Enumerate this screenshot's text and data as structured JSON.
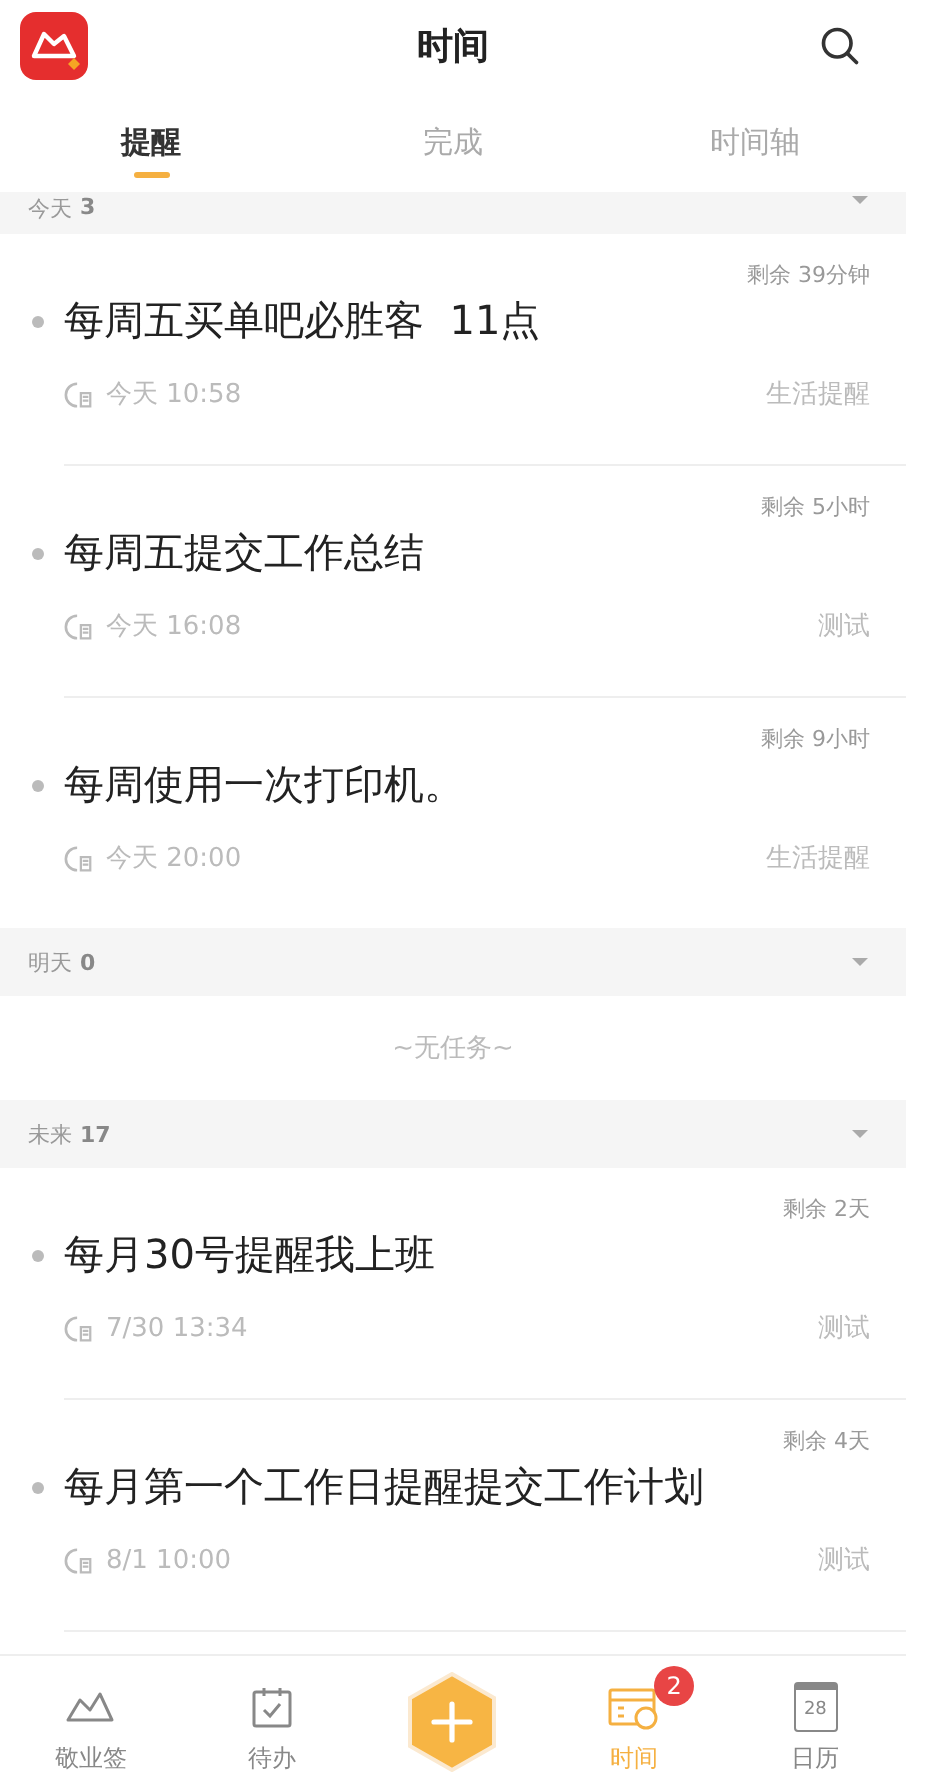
{
  "header": {
    "title": "时间"
  },
  "tabs": [
    {
      "label": "提醒",
      "selected": true
    },
    {
      "label": "完成",
      "selected": false
    },
    {
      "label": "时间轴",
      "selected": false
    }
  ],
  "groups": [
    {
      "label": "今天",
      "count": "3",
      "expanded": true,
      "items": [
        {
          "remaining": "剩余 39分钟",
          "title": "每周五买单吧必胜客  11点",
          "time": "今天 10:58",
          "tag": "生活提醒"
        },
        {
          "remaining": "剩余 5小时",
          "title": "每周五提交工作总结",
          "time": "今天 16:08",
          "tag": "测试"
        },
        {
          "remaining": "剩余 9小时",
          "title": "每周使用一次打印机。",
          "time": "今天 20:00",
          "tag": "生活提醒"
        }
      ]
    },
    {
      "label": "明天",
      "count": "0",
      "expanded": true,
      "empty": "~无任务~"
    },
    {
      "label": "未来",
      "count": "17",
      "expanded": true,
      "items": [
        {
          "remaining": "剩余 2天",
          "title": "每月30号提醒我上班",
          "time": "7/30 13:34",
          "tag": "测试"
        },
        {
          "remaining": "剩余 4天",
          "title": "每月第一个工作日提醒提交工作计划",
          "time": "8/1 10:00",
          "tag": "测试"
        }
      ]
    }
  ],
  "nav": [
    {
      "kind": "note",
      "label": "敬业签",
      "selected": false
    },
    {
      "kind": "todo",
      "label": "待办",
      "selected": false
    },
    {
      "kind": "add"
    },
    {
      "kind": "time",
      "label": "时间",
      "selected": true,
      "badge": "2"
    },
    {
      "kind": "calendar",
      "label": "日历",
      "selected": false,
      "day": "28"
    }
  ]
}
